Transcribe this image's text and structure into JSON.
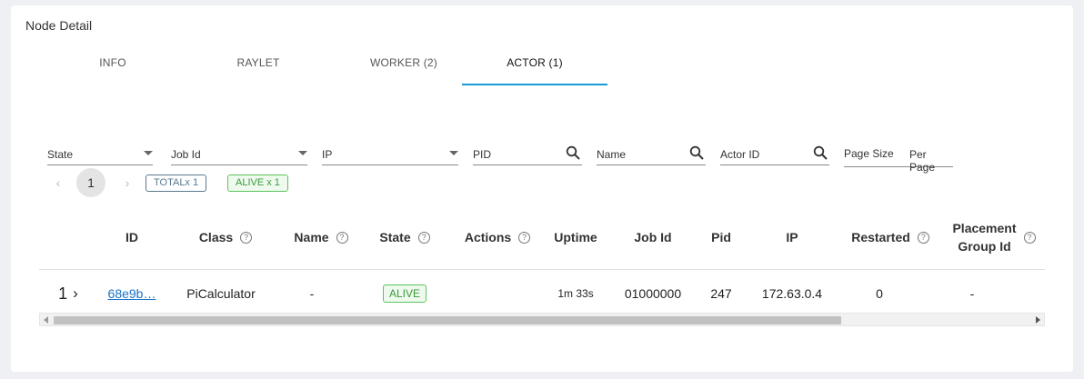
{
  "title": "Node Detail",
  "tabs": [
    {
      "label": "INFO"
    },
    {
      "label": "RAYLET"
    },
    {
      "label": "WORKER (2)"
    },
    {
      "label": "ACTOR (1)"
    }
  ],
  "active_tab": "ACTOR (1)",
  "filters": {
    "state": "State",
    "job_id": "Job Id",
    "ip": "IP",
    "pid": "PID",
    "name": "Name",
    "actor_id": "Actor ID",
    "page_size": "Page Size",
    "per_page": "Per Page"
  },
  "pagination": {
    "prev": "‹",
    "page": "1",
    "next": "›"
  },
  "summary": {
    "total": "TOTALx 1",
    "alive": "ALIVE x 1"
  },
  "columns": {
    "id": "ID",
    "class": "Class",
    "name": "Name",
    "state": "State",
    "actions": "Actions",
    "uptime": "Uptime",
    "job_id": "Job Id",
    "pid": "Pid",
    "ip": "IP",
    "restarted": "Restarted",
    "placement_group_line1": "Placement",
    "placement_group_line2": "Group Id"
  },
  "help_glyph": "?",
  "rows": [
    {
      "index": "1",
      "expand": "›",
      "id": "68e9b…",
      "class": "PiCalculator",
      "name": "-",
      "state": "ALIVE",
      "actions": "",
      "uptime": "1m 33s",
      "job_id": "01000000",
      "pid": "247",
      "ip": "172.63.0.4",
      "restarted": "0",
      "placement_group": "-"
    }
  ],
  "colors": {
    "accent": "#1a9bd7",
    "alive": "#3b9a3b",
    "link": "#1a73c7"
  }
}
